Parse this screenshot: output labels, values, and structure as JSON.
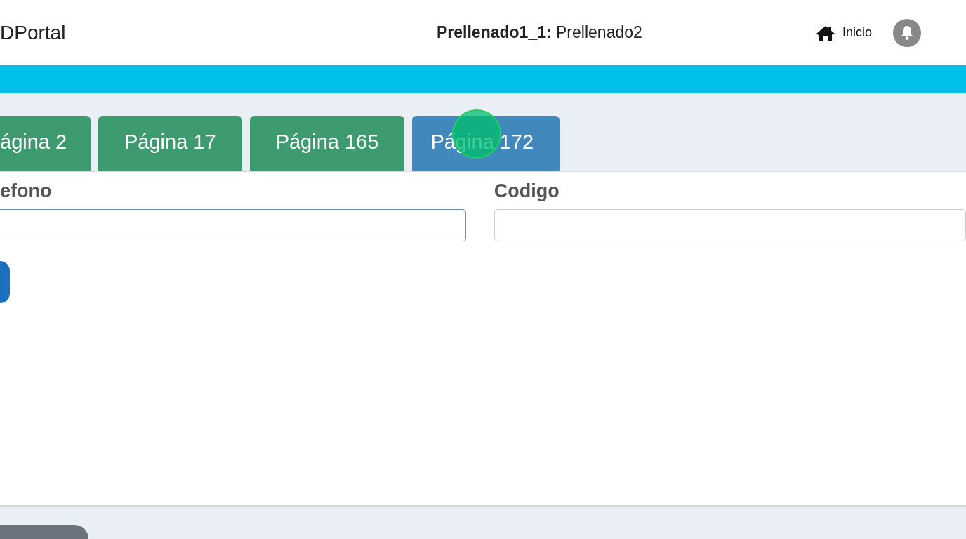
{
  "header": {
    "brand": "DPortal",
    "title": "**Prellenado1_1:** Prellenado2",
    "nav_link": "Inicio"
  },
  "tabs": [
    {
      "label": "ágina 2",
      "selected": false
    },
    {
      "label": "Página 17",
      "selected": false
    },
    {
      "label": "Página 165",
      "selected": false
    },
    {
      "label": "Página 172",
      "selected": true
    }
  ],
  "fields": [
    {
      "label": "efono",
      "focused": true
    },
    {
      "label": "Codigo",
      "focused": false
    }
  ]
}
